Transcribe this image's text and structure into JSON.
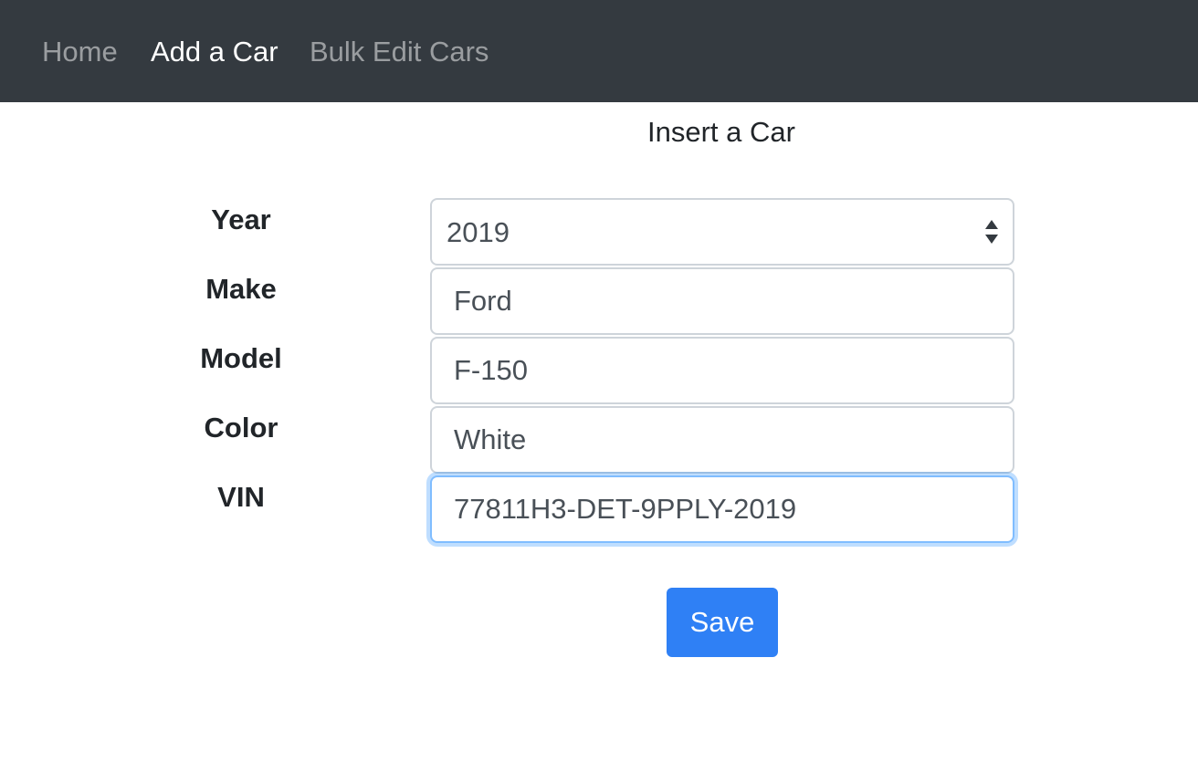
{
  "nav": {
    "items": [
      {
        "label": "Home"
      },
      {
        "label": "Add a Car"
      },
      {
        "label": "Bulk Edit Cars"
      }
    ]
  },
  "form": {
    "title": "Insert a Car",
    "fields": {
      "year": {
        "label": "Year",
        "value": "2019"
      },
      "make": {
        "label": "Make",
        "value": "Ford"
      },
      "model": {
        "label": "Model",
        "value": "F-150"
      },
      "color": {
        "label": "Color",
        "value": "White"
      },
      "vin": {
        "label": "VIN",
        "value": "77811H3-DET-9PPLY-2019"
      }
    },
    "save_label": "Save"
  },
  "colors": {
    "navbar": "#343a40",
    "accent": "#2f80f5",
    "focus_border": "#80bdff"
  }
}
